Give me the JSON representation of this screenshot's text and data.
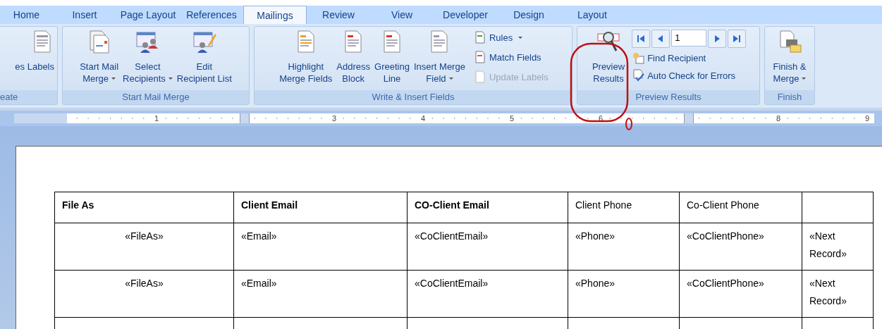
{
  "tabs": [
    {
      "label": "Home",
      "selected": false
    },
    {
      "label": "Insert",
      "selected": false
    },
    {
      "label": "Page Layout",
      "selected": false
    },
    {
      "label": "References",
      "selected": false
    },
    {
      "label": "Mailings",
      "selected": true
    },
    {
      "label": "Review",
      "selected": false
    },
    {
      "label": "View",
      "selected": false
    },
    {
      "label": "Developer",
      "selected": false
    },
    {
      "label": "Design",
      "selected": false
    },
    {
      "label": "Layout",
      "selected": false
    }
  ],
  "groups": [
    {
      "label": "eate",
      "items": [
        {
          "kind": "big",
          "lines": [
            "es Labels"
          ],
          "dropdown": false
        }
      ]
    },
    {
      "label": "Start Mail Merge",
      "items": [
        {
          "kind": "big",
          "lines": [
            "Start Mail",
            "Merge"
          ],
          "dropdown": true
        },
        {
          "kind": "big",
          "lines": [
            "Select",
            "Recipients"
          ],
          "dropdown": true
        },
        {
          "kind": "big",
          "lines": [
            "Edit",
            "Recipient List"
          ],
          "dropdown": false
        }
      ]
    },
    {
      "label": "Write & Insert Fields",
      "items": [
        {
          "kind": "big",
          "lines": [
            "Highlight",
            "Merge Fields"
          ],
          "dropdown": false
        },
        {
          "kind": "big",
          "lines": [
            "Address",
            "Block"
          ],
          "dropdown": false
        },
        {
          "kind": "big",
          "lines": [
            "Greeting",
            "Line"
          ],
          "dropdown": false
        },
        {
          "kind": "big",
          "lines": [
            "Insert Merge",
            "Field"
          ],
          "dropdown": true
        },
        {
          "kind": "small-stack",
          "items": [
            {
              "label": "Rules",
              "dropdown": true,
              "disabled": false
            },
            {
              "label": "Match Fields",
              "dropdown": false,
              "disabled": false
            },
            {
              "label": "Update Labels",
              "dropdown": false,
              "disabled": true
            }
          ]
        }
      ]
    },
    {
      "label": "Preview Results",
      "items": [
        {
          "kind": "big",
          "lines": [
            "Preview",
            "Results"
          ],
          "dropdown": false
        },
        {
          "kind": "navigator",
          "record": "1",
          "items": [
            {
              "label": "Find Recipient",
              "dropdown": false,
              "disabled": false
            },
            {
              "label": "Auto Check for Errors",
              "dropdown": false,
              "disabled": false
            }
          ]
        }
      ]
    },
    {
      "label": "Finish",
      "items": [
        {
          "kind": "big",
          "lines": [
            "Finish &",
            "Merge"
          ],
          "dropdown": true
        }
      ]
    }
  ],
  "ruler": [
    {
      "kind": "number",
      "text": "1"
    },
    {
      "kind": "marker"
    },
    {
      "kind": "number",
      "text": "3"
    },
    {
      "kind": "number",
      "text": "4"
    },
    {
      "kind": "number",
      "text": "5"
    },
    {
      "kind": "number",
      "text": "6"
    },
    {
      "kind": "marker"
    },
    {
      "kind": "number",
      "text": "8"
    },
    {
      "kind": "number",
      "text": "9"
    }
  ],
  "table": {
    "columns": [
      {
        "label": "File As",
        "bold": true
      },
      {
        "label": "Client Email",
        "bold": true
      },
      {
        "label": "CO-Client Email",
        "bold": true
      },
      {
        "label": "Client Phone",
        "bold": false
      },
      {
        "label": "Co-Client Phone",
        "bold": false
      }
    ],
    "rows": [
      [
        "«FileAs»",
        "«Email»",
        "«CoClientEmail»",
        "«Phone»",
        "«CoClientPhone»",
        "«Next Record»"
      ],
      [
        "«FileAs»",
        "«Email»",
        "«CoClientEmail»",
        "«Phone»",
        "«CoClientPhone»",
        "«Next Record»"
      ]
    ]
  }
}
